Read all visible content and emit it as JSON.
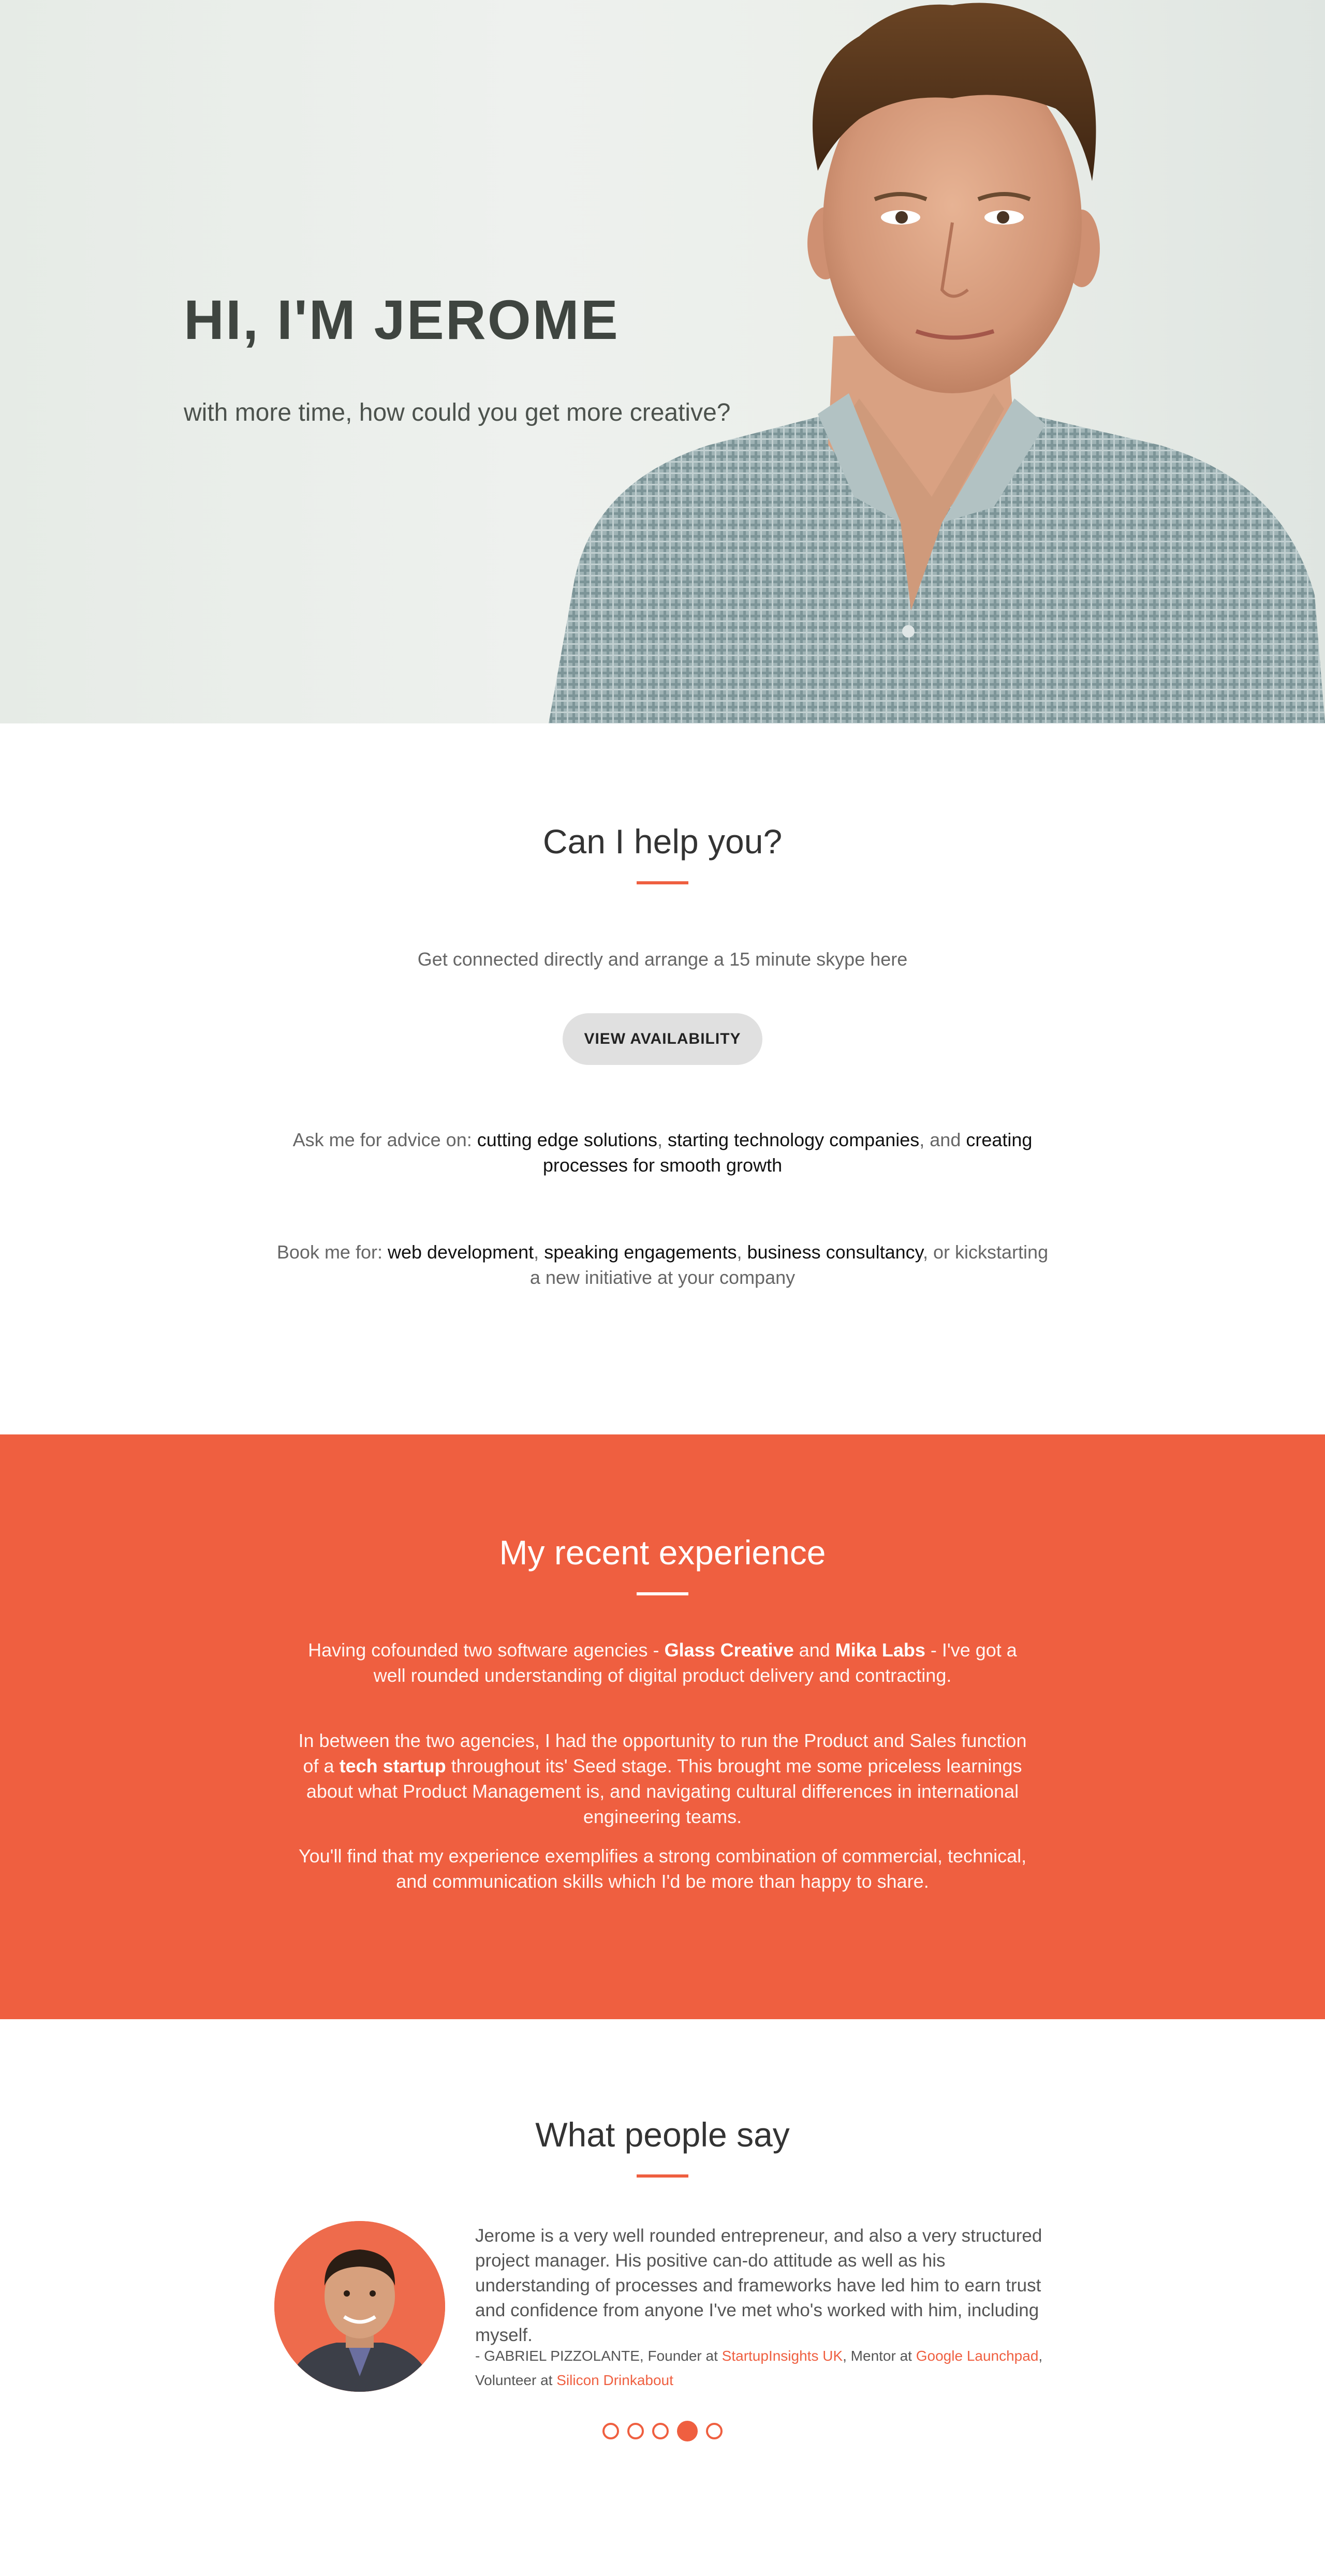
{
  "hero": {
    "title": "HI, I'M JEROME",
    "subtitle": "with more time, how could you get more creative?"
  },
  "help": {
    "title": "Can I help you?",
    "intro": "Get connected directly and arrange a 15 minute skype here",
    "button_label": "VIEW AVAILABILITY",
    "advice": {
      "prefix": "Ask me for advice on: ",
      "item1": "cutting edge solutions",
      "sep1": ", ",
      "item2": "starting technology companies",
      "sep2": ", and ",
      "item3": "creating processes for smooth growth"
    },
    "book": {
      "prefix": "Book me for: ",
      "item1": "web development",
      "sep1": ", ",
      "item2": "speaking engagements",
      "sep2": ", ",
      "item3": "business consultancy",
      "suffix": ", or kickstarting a new initiative at your company"
    }
  },
  "experience": {
    "title": "My recent experience",
    "p1": {
      "a": "Having cofounded two software agencies - ",
      "b1": "Glass Creative",
      "c": " and ",
      "b2": "Mika Labs",
      "d": " - I've got a well rounded understanding of digital product delivery and contracting."
    },
    "p2": {
      "a": "In between the two agencies, I had the opportunity to run the Product and Sales function of a ",
      "b1": "tech startup",
      "c": " throughout its' Seed stage. This brought me some priceless learnings about what Product Management is, and navigating cultural differences in international engineering teams."
    },
    "p3": "You'll find that my experience exemplifies a strong combination of commercial, technical, and communication skills which I'd be more than happy to share."
  },
  "testimonials": {
    "title": "What people say",
    "quote": "Jerome is a very well rounded entrepreneur, and also a very structured project manager. His positive can-do attitude as well as his understanding of processes and frameworks have led him to earn trust and confidence from anyone I've met who's worked with him, including myself.",
    "attribution": {
      "a": "- GABRIEL PIZZOLANTE, Founder at ",
      "link1": "StartupInsights UK",
      "b": ", Mentor at ",
      "link2": "Google Launchpad",
      "c": ", Volunteer at ",
      "link3": "Silicon Drinkabout"
    },
    "slide_count": 5,
    "active_slide": 4
  },
  "colors": {
    "accent": "#ef5f40",
    "hero_bg": "#e8ece8"
  }
}
